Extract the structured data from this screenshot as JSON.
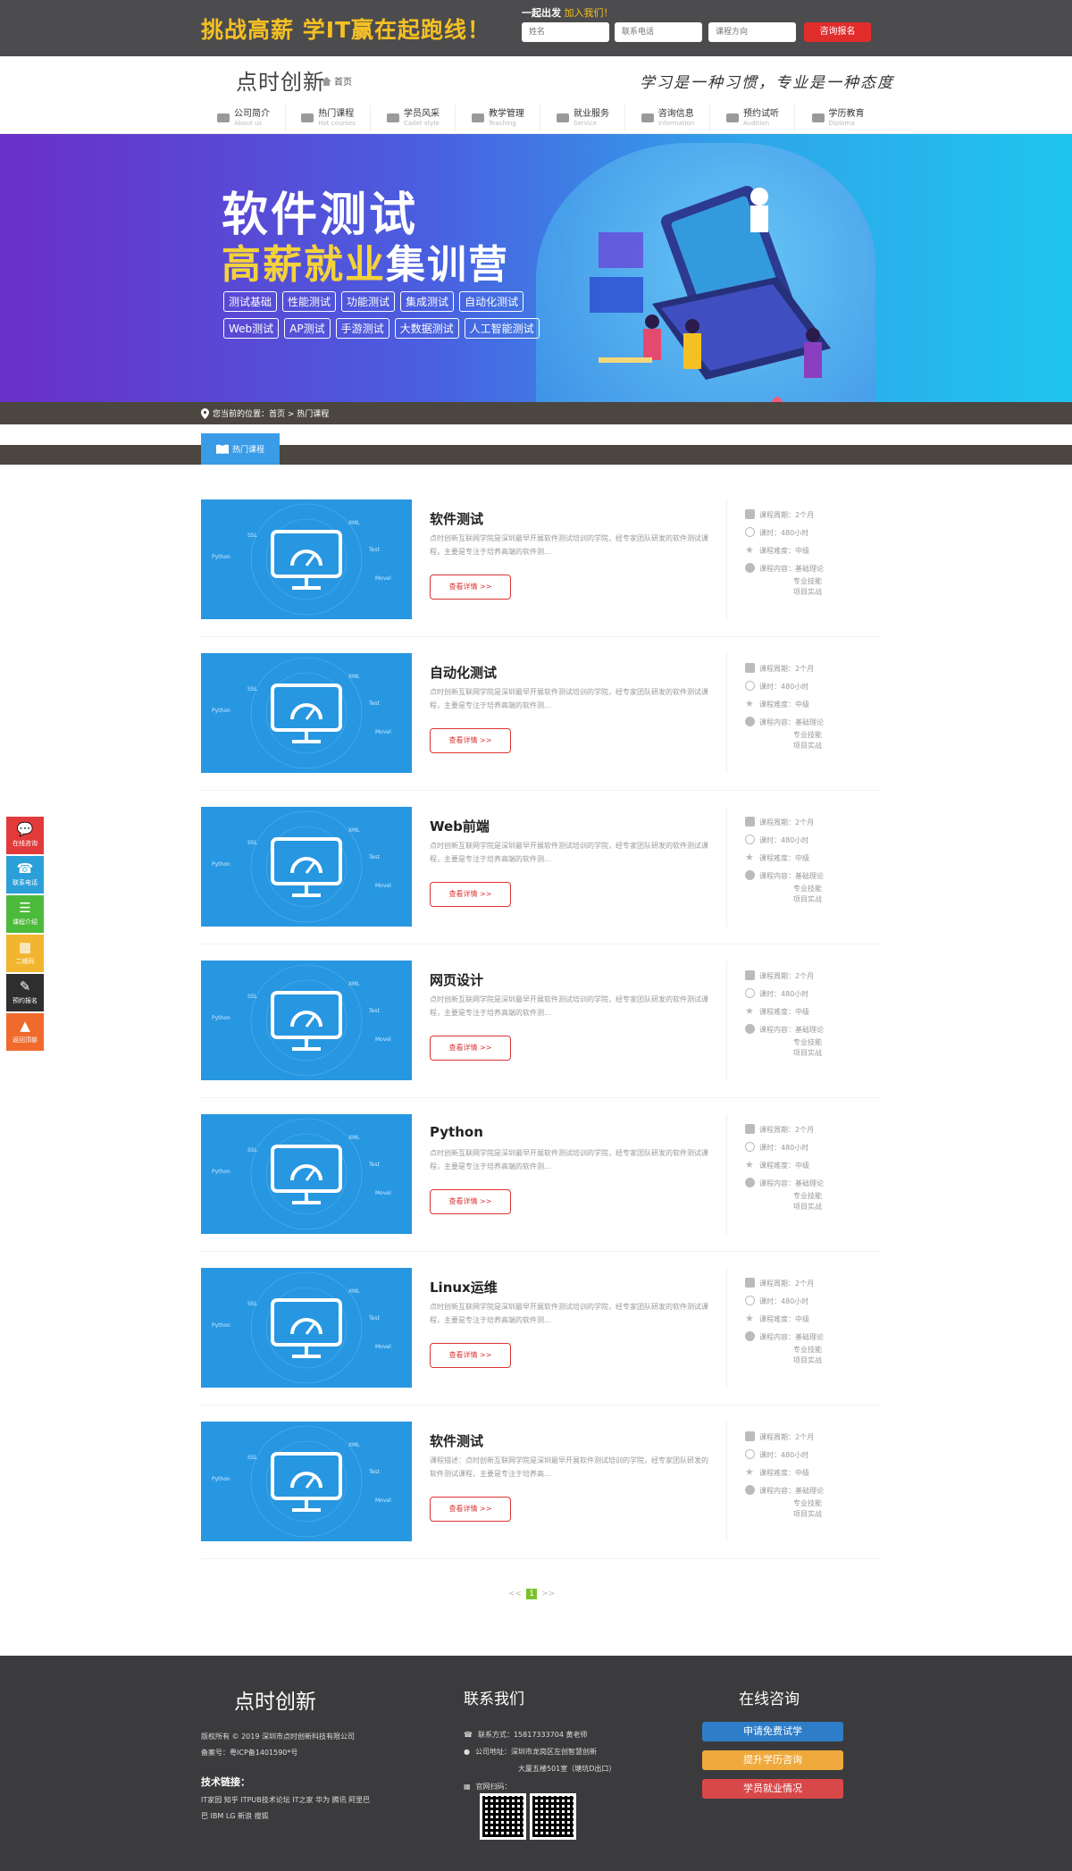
{
  "topbar": {
    "slogan": "挑战高薪 学IT赢在起跑线！",
    "join_prefix": "一起出发",
    "join_link": "加入我们！",
    "name_placeholder": "姓名",
    "phone_placeholder": "联系电话",
    "direction_placeholder": "课程方向",
    "consult_button": "咨询报名"
  },
  "header": {
    "logo_text": "点时创新",
    "home_label": "首页",
    "motto": "学习是一种习惯，专业是一种态度",
    "nav": [
      {
        "cn": "公司简介",
        "en": "About us",
        "icon": "company-icon"
      },
      {
        "cn": "热门课程",
        "en": "Hot courses",
        "icon": "book-icon"
      },
      {
        "cn": "学员风采",
        "en": "Cadet style",
        "icon": "graduate-icon"
      },
      {
        "cn": "教学管理",
        "en": "Teaching",
        "icon": "projector-icon"
      },
      {
        "cn": "就业服务",
        "en": "Service",
        "icon": "briefcase-icon"
      },
      {
        "cn": "咨询信息",
        "en": "Information",
        "icon": "chat-icon"
      },
      {
        "cn": "预约试听",
        "en": "Audition",
        "icon": "headphones-icon"
      },
      {
        "cn": "学历教育",
        "en": "Diploma",
        "icon": "person-icon"
      }
    ]
  },
  "banner": {
    "title1": "软件测试",
    "title2_highlight": "高薪就业",
    "title2_rest": "集训营",
    "tags": [
      "测试基础",
      "性能测试",
      "功能测试",
      "集成测试",
      "自动化测试",
      "Web测试",
      "AP测试",
      "手游测试",
      "大数据测试",
      "人工智能测试"
    ]
  },
  "breadcrumb": {
    "text": "您当前的位置：首页 > 热门课程"
  },
  "tab": {
    "label": "热门课程"
  },
  "courses": [
    {
      "title": "软件测试",
      "desc": "点时创新互联网学院是深圳最早开展软件测试培训的学院，经专家团队研发的软件测试课程，主要是专注于培养高端的软件测...",
      "button": "查看详情 >>"
    },
    {
      "title": "自动化测试",
      "desc": "点时创新互联网学院是深圳最早开展软件测试培训的学院，经专家团队研发的软件测试课程，主要是专注于培养高端的软件测...",
      "button": "查看详情 >>"
    },
    {
      "title": "Web前端",
      "desc": "点时创新互联网学院是深圳最早开展软件测试培训的学院，经专家团队研发的软件测试课程，主要是专注于培养高端的软件测...",
      "button": "查看详情 >>"
    },
    {
      "title": "网页设计",
      "desc": "点时创新互联网学院是深圳最早开展软件测试培训的学院，经专家团队研发的软件测试课程，主要是专注于培养高端的软件测...",
      "button": "查看详情 >>"
    },
    {
      "title": "Python",
      "desc": "点时创新互联网学院是深圳最早开展软件测试培训的学院，经专家团队研发的软件测试课程，主要是专注于培养高端的软件测...",
      "button": "查看详情 >>"
    },
    {
      "title": "Linux运维",
      "desc": "点时创新互联网学院是深圳最早开展软件测试培训的学院，经专家团队研发的软件测试课程，主要是专注于培养高端的软件测...",
      "button": "查看详情 >>"
    },
    {
      "title": "软件测试",
      "desc": "课程描述：点时创新互联网学院是深圳最早开展软件测试培训的学院，经专家团队研发的软件测试课程，主要是专注于培养高...",
      "button": "查看详情 >>"
    }
  ],
  "meta": {
    "period": "课程周期：2个月",
    "hours": "课时：480小时",
    "difficulty": "课程难度：中级",
    "content": "课程内容：基础理论",
    "content2": "专业技能",
    "content3": "项目实战"
  },
  "thumb_labels": [
    "SSL",
    "XML",
    "Test",
    "Python",
    "Movel"
  ],
  "pager": {
    "prev": "<<",
    "current": "1",
    "next": ">>"
  },
  "side": [
    {
      "label": "在线咨询",
      "color": "#e23a3a",
      "icon": "chat-bubble-icon"
    },
    {
      "label": "联系电话",
      "color": "#2b9fd8",
      "icon": "phone-icon"
    },
    {
      "label": "课程介绍",
      "color": "#4cba3a",
      "icon": "list-icon"
    },
    {
      "label": "二维码",
      "color": "#f2b52f",
      "icon": "qrcode-icon"
    },
    {
      "label": "预约报名",
      "color": "#2e2e2e",
      "icon": "edit-icon"
    },
    {
      "label": "返回顶部",
      "color": "#ef6a2c",
      "icon": "rocket-icon"
    }
  ],
  "footer": {
    "logo_text": "点时创新",
    "copyright": "版权所有 © 2019 深圳市点时创新科技有限公司",
    "icp": "备案号：粤ICP备1401590*号",
    "links_title": "技术链接：",
    "links": "IT家园  知乎  ITPUB技术论坛  IT之家  华为  腾讯  阿里巴巴  IBM  LG  新浪  搜狐",
    "contact_title": "联系我们",
    "phone": "联系方式：15817333704 黄老师",
    "address": "公司地址：深圳市龙岗区左创智慧创新",
    "address2": "大厦五楼501室（塘坑D出口）",
    "wechat": "官网扫码：",
    "online_title": "在线咨询",
    "btn1": "申请免费试学",
    "btn2": "提升学历咨询",
    "btn3": "学员就业情况"
  },
  "colors": {
    "accent_blue": "#3a9be7",
    "accent_red": "#e12c2c",
    "dark_bar": "#4b463f",
    "footer_bg": "#3b3b3d"
  }
}
